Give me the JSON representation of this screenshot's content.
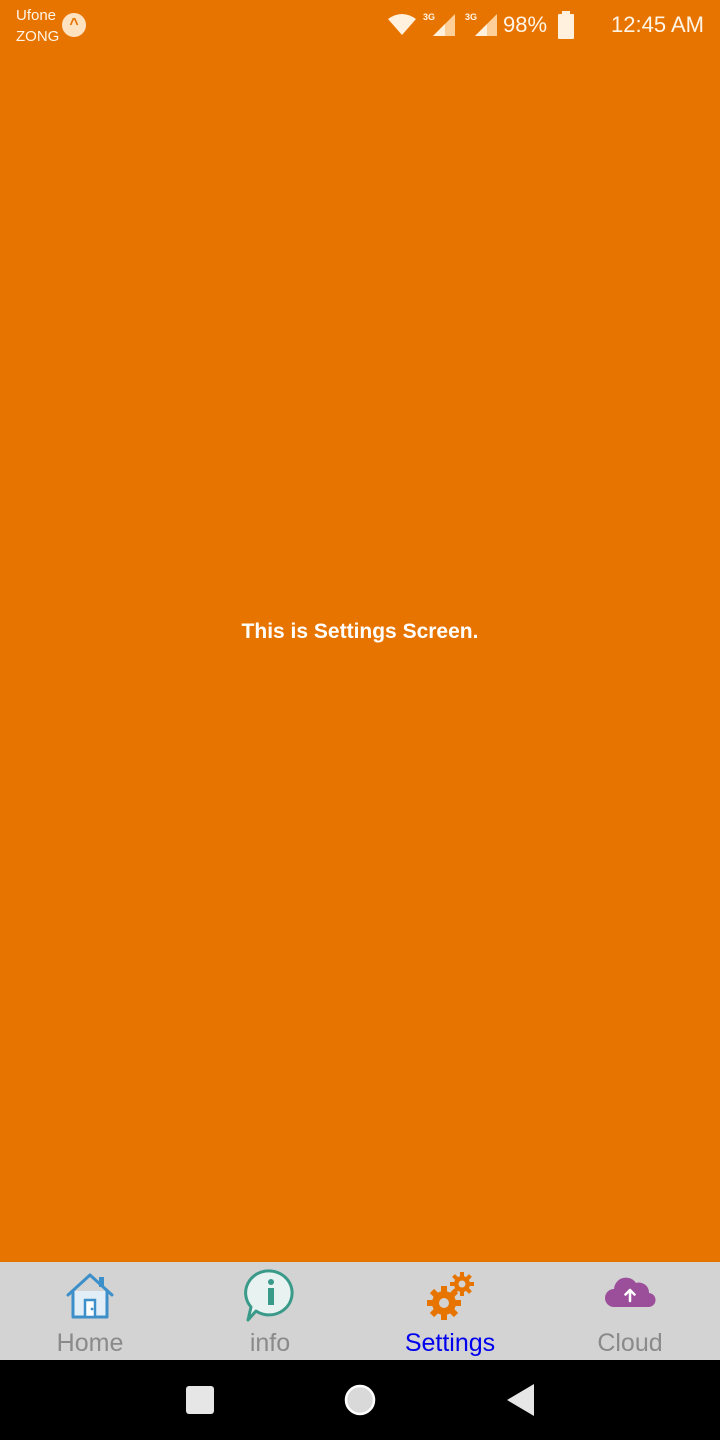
{
  "status_bar": {
    "carrier_1": "Ufone",
    "carrier_2": "ZONG",
    "carrier_badge": "^",
    "network_1": "3G",
    "network_2": "3G",
    "battery": "98%",
    "time": "12:45 AM"
  },
  "main": {
    "message": "This is Settings Screen.",
    "background_color": "#e87400"
  },
  "tabs": [
    {
      "label": "Home",
      "icon": "home-icon",
      "active": false,
      "color": "#3c8fc9"
    },
    {
      "label": "info",
      "icon": "info-icon",
      "active": false,
      "color": "#3a9a8a"
    },
    {
      "label": "Settings",
      "icon": "gears-icon",
      "active": true,
      "color": "#e87400"
    },
    {
      "label": "Cloud",
      "icon": "cloud-upload-icon",
      "active": false,
      "color": "#9b4f9b"
    }
  ],
  "nav": {
    "buttons": [
      "recents-button",
      "home-button",
      "back-button"
    ]
  }
}
